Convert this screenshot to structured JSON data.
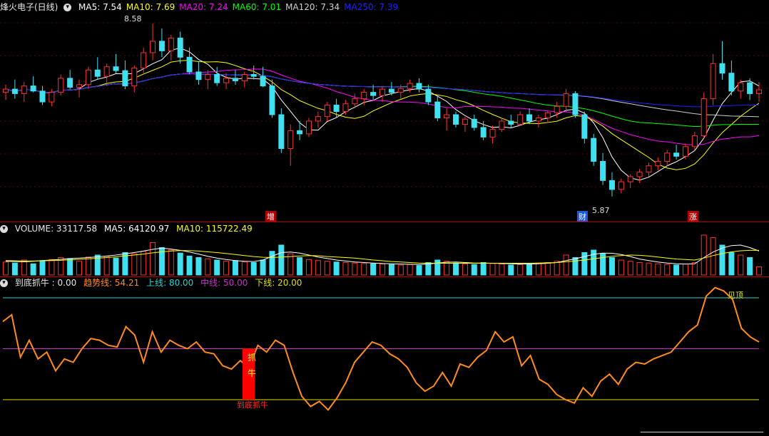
{
  "price_header": {
    "title": "烽火电子(日线)",
    "ma": [
      {
        "label": "MA5: 7.54",
        "color": "#ffffff"
      },
      {
        "label": "MA10: 7.69",
        "color": "#ffff00"
      },
      {
        "label": "MA20: 7.24",
        "color": "#ff00ff"
      },
      {
        "label": "MA60: 7.01",
        "color": "#00ff00"
      },
      {
        "label": "MA120: 7.34",
        "color": "#d0d0d0"
      },
      {
        "label": "MA250: 7.39",
        "color": "#2020ff"
      }
    ]
  },
  "price_annotations": {
    "high": "8.58",
    "low": "5.87"
  },
  "markers": [
    {
      "text": "增",
      "color": "#ff4040"
    },
    {
      "text": "财",
      "color": "#2a60ff"
    },
    {
      "text": "涨",
      "color": "#ff4040"
    }
  ],
  "volume_header": {
    "title": "VOLUME: 33117.58",
    "ma5": "MA5: 64120.97",
    "ma10": "MA10: 115722.49"
  },
  "indicator_header": {
    "title": "到底抓牛 : 0.00",
    "trend": "趋势线: 54.21",
    "upper": "上线: 80.00",
    "middle": "中线: 50.00",
    "lower": "下线: 20.00"
  },
  "indicator_labels": {
    "top": "见顶",
    "signal": [
      "抓",
      "牛"
    ],
    "bottom": "到底抓牛"
  },
  "colors": {
    "up": "#ff3030",
    "down": "#40e0f0",
    "ma5": "#ffffff",
    "ma10": "#ffff00",
    "ma20": "#ff00ff",
    "ma60": "#00ff00",
    "ma120": "#d0d0d0",
    "ma250": "#2020ff",
    "trend": "#ff8c1a",
    "upper": "#30d0d0",
    "middle": "#cc30cc",
    "lower": "#e0e000"
  },
  "chart_data": {
    "type": "candlestick",
    "price_range": [
      5.6,
      8.7
    ],
    "candles_ohlc": [
      [
        7.5,
        7.62,
        7.38,
        7.55
      ],
      [
        7.55,
        7.7,
        7.4,
        7.48
      ],
      [
        7.48,
        7.66,
        7.35,
        7.6
      ],
      [
        7.6,
        7.75,
        7.5,
        7.52
      ],
      [
        7.52,
        7.6,
        7.3,
        7.35
      ],
      [
        7.35,
        7.55,
        7.28,
        7.5
      ],
      [
        7.5,
        7.78,
        7.45,
        7.72
      ],
      [
        7.72,
        7.85,
        7.55,
        7.58
      ],
      [
        7.58,
        7.7,
        7.42,
        7.62
      ],
      [
        7.62,
        7.9,
        7.55,
        7.85
      ],
      [
        7.85,
        8.05,
        7.7,
        7.75
      ],
      [
        7.75,
        7.95,
        7.6,
        7.9
      ],
      [
        7.9,
        8.1,
        7.8,
        7.84
      ],
      [
        7.84,
        8.0,
        7.55,
        7.6
      ],
      [
        7.6,
        7.92,
        7.5,
        7.88
      ],
      [
        7.88,
        8.2,
        7.8,
        8.12
      ],
      [
        8.12,
        8.58,
        8.0,
        8.3
      ],
      [
        8.3,
        8.5,
        8.05,
        8.15
      ],
      [
        8.15,
        8.4,
        8.0,
        8.35
      ],
      [
        8.35,
        8.45,
        7.95,
        8.05
      ],
      [
        8.05,
        8.2,
        7.78,
        7.82
      ],
      [
        7.82,
        7.98,
        7.62,
        7.7
      ],
      [
        7.7,
        7.85,
        7.55,
        7.78
      ],
      [
        7.78,
        7.9,
        7.6,
        7.65
      ],
      [
        7.65,
        7.8,
        7.55,
        7.72
      ],
      [
        7.72,
        7.85,
        7.62,
        7.68
      ],
      [
        7.68,
        7.82,
        7.58,
        7.78
      ],
      [
        7.78,
        7.92,
        7.7,
        7.75
      ],
      [
        7.75,
        7.9,
        7.58,
        7.6
      ],
      [
        7.6,
        7.7,
        7.1,
        7.15
      ],
      [
        7.15,
        7.25,
        6.55,
        6.62
      ],
      [
        6.62,
        7.0,
        6.35,
        6.9
      ],
      [
        6.9,
        7.05,
        6.75,
        6.85
      ],
      [
        6.85,
        7.1,
        6.8,
        7.05
      ],
      [
        7.05,
        7.2,
        6.95,
        7.12
      ],
      [
        7.12,
        7.35,
        7.05,
        7.3
      ],
      [
        7.3,
        7.4,
        7.1,
        7.2
      ],
      [
        7.2,
        7.38,
        7.15,
        7.32
      ],
      [
        7.32,
        7.48,
        7.25,
        7.4
      ],
      [
        7.4,
        7.55,
        7.3,
        7.5
      ],
      [
        7.5,
        7.62,
        7.38,
        7.45
      ],
      [
        7.45,
        7.6,
        7.35,
        7.55
      ],
      [
        7.55,
        7.66,
        7.45,
        7.5
      ],
      [
        7.5,
        7.62,
        7.4,
        7.56
      ],
      [
        7.56,
        7.7,
        7.5,
        7.64
      ],
      [
        7.64,
        7.72,
        7.5,
        7.55
      ],
      [
        7.55,
        7.62,
        7.3,
        7.35
      ],
      [
        7.35,
        7.45,
        7.05,
        7.1
      ],
      [
        7.1,
        7.25,
        6.9,
        7.15
      ],
      [
        7.15,
        7.2,
        6.95,
        7.0
      ],
      [
        7.0,
        7.12,
        6.88,
        7.08
      ],
      [
        7.08,
        7.15,
        6.9,
        6.95
      ],
      [
        6.95,
        7.05,
        6.75,
        6.8
      ],
      [
        6.8,
        6.98,
        6.7,
        6.92
      ],
      [
        6.92,
        7.1,
        6.88,
        7.05
      ],
      [
        7.05,
        7.15,
        6.95,
        7.0
      ],
      [
        7.0,
        7.2,
        6.98,
        7.15
      ],
      [
        7.15,
        7.25,
        7.0,
        7.05
      ],
      [
        7.05,
        7.15,
        6.95,
        7.1
      ],
      [
        7.1,
        7.22,
        7.02,
        7.18
      ],
      [
        7.18,
        7.35,
        7.1,
        7.28
      ],
      [
        7.28,
        7.55,
        7.2,
        7.48
      ],
      [
        7.48,
        7.52,
        7.1,
        7.15
      ],
      [
        7.15,
        7.2,
        6.7,
        6.78
      ],
      [
        6.78,
        6.85,
        6.35,
        6.42
      ],
      [
        6.42,
        6.55,
        6.05,
        6.12
      ],
      [
        6.12,
        6.25,
        5.87,
        5.98
      ],
      [
        5.98,
        6.15,
        5.92,
        6.1
      ],
      [
        6.1,
        6.22,
        6.0,
        6.18
      ],
      [
        6.18,
        6.3,
        6.08,
        6.25
      ],
      [
        6.25,
        6.4,
        6.18,
        6.35
      ],
      [
        6.35,
        6.48,
        6.28,
        6.42
      ],
      [
        6.42,
        6.6,
        6.35,
        6.55
      ],
      [
        6.55,
        6.68,
        6.45,
        6.5
      ],
      [
        6.5,
        6.7,
        6.45,
        6.65
      ],
      [
        6.65,
        6.88,
        6.6,
        6.82
      ],
      [
        6.82,
        7.5,
        6.78,
        7.4
      ],
      [
        7.4,
        8.1,
        7.3,
        7.95
      ],
      [
        7.95,
        8.3,
        7.7,
        7.8
      ],
      [
        7.8,
        8.0,
        7.45,
        7.52
      ],
      [
        7.52,
        7.7,
        7.4,
        7.65
      ],
      [
        7.65,
        7.72,
        7.38,
        7.48
      ],
      [
        7.48,
        7.66,
        7.35,
        7.54
      ]
    ],
    "volume_range": [
      0,
      160000
    ],
    "volume": [
      52,
      48,
      60,
      45,
      58,
      62,
      70,
      66,
      55,
      72,
      80,
      75,
      68,
      90,
      85,
      95,
      130,
      110,
      100,
      88,
      76,
      70,
      65,
      60,
      55,
      58,
      52,
      50,
      60,
      95,
      120,
      85,
      70,
      62,
      58,
      55,
      52,
      50,
      48,
      46,
      45,
      44,
      42,
      40,
      42,
      38,
      50,
      60,
      55,
      48,
      45,
      42,
      50,
      46,
      44,
      40,
      42,
      45,
      48,
      50,
      55,
      80,
      70,
      90,
      100,
      85,
      70,
      60,
      55,
      50,
      48,
      45,
      42,
      40,
      44,
      50,
      160,
      150,
      120,
      90,
      80,
      70,
      33
    ],
    "volume_ma5": [
      55,
      54,
      53,
      55,
      58,
      60,
      63,
      66,
      68,
      70,
      73,
      76,
      80,
      85,
      90,
      96,
      103,
      108,
      104,
      99,
      92,
      84,
      75,
      68,
      62,
      58,
      55,
      54,
      60,
      75,
      90,
      92,
      88,
      80,
      72,
      66,
      60,
      56,
      52,
      50,
      48,
      46,
      45,
      44,
      43,
      42,
      44,
      48,
      51,
      52,
      50,
      48,
      48,
      47,
      46,
      45,
      44,
      44,
      45,
      47,
      50,
      58,
      65,
      74,
      83,
      88,
      87,
      82,
      74,
      64,
      58,
      52,
      48,
      45,
      44,
      45,
      70,
      92,
      108,
      118,
      120,
      110,
      96
    ],
    "volume_ma10": [
      58,
      57,
      56,
      56,
      57,
      58,
      59,
      61,
      63,
      65,
      67,
      70,
      73,
      77,
      80,
      84,
      89,
      93,
      96,
      98,
      98,
      96,
      93,
      90,
      86,
      82,
      78,
      74,
      71,
      70,
      72,
      74,
      76,
      78,
      77,
      74,
      72,
      70,
      68,
      64,
      60,
      57,
      54,
      52,
      50,
      48,
      47,
      47,
      47,
      47,
      47,
      47,
      47,
      47,
      47,
      47,
      47,
      47,
      48,
      49,
      50,
      53,
      56,
      60,
      65,
      70,
      75,
      78,
      80,
      79,
      76,
      72,
      68,
      64,
      62,
      60,
      68,
      78,
      86,
      93,
      97,
      99,
      99
    ],
    "indicator_range": [
      0,
      100
    ],
    "indicator_lines": {
      "upper": 80,
      "middle": 50,
      "lower": 20
    },
    "trend": [
      66,
      70,
      45,
      55,
      44,
      48,
      37,
      44,
      42,
      50,
      56,
      55,
      52,
      51,
      63,
      58,
      42,
      60,
      48,
      55,
      52,
      50,
      54,
      48,
      47,
      40,
      38,
      43,
      39,
      52,
      48,
      55,
      52,
      36,
      22,
      16,
      19,
      14,
      21,
      30,
      42,
      48,
      54,
      52,
      47,
      44,
      39,
      30,
      25,
      28,
      36,
      28,
      41,
      39,
      45,
      49,
      60,
      54,
      57,
      40,
      46,
      32,
      29,
      23,
      20,
      18,
      27,
      22,
      31,
      35,
      29,
      38,
      42,
      41,
      44,
      46,
      48,
      54,
      60,
      64,
      81,
      86,
      84,
      79,
      62,
      57,
      54
    ]
  }
}
